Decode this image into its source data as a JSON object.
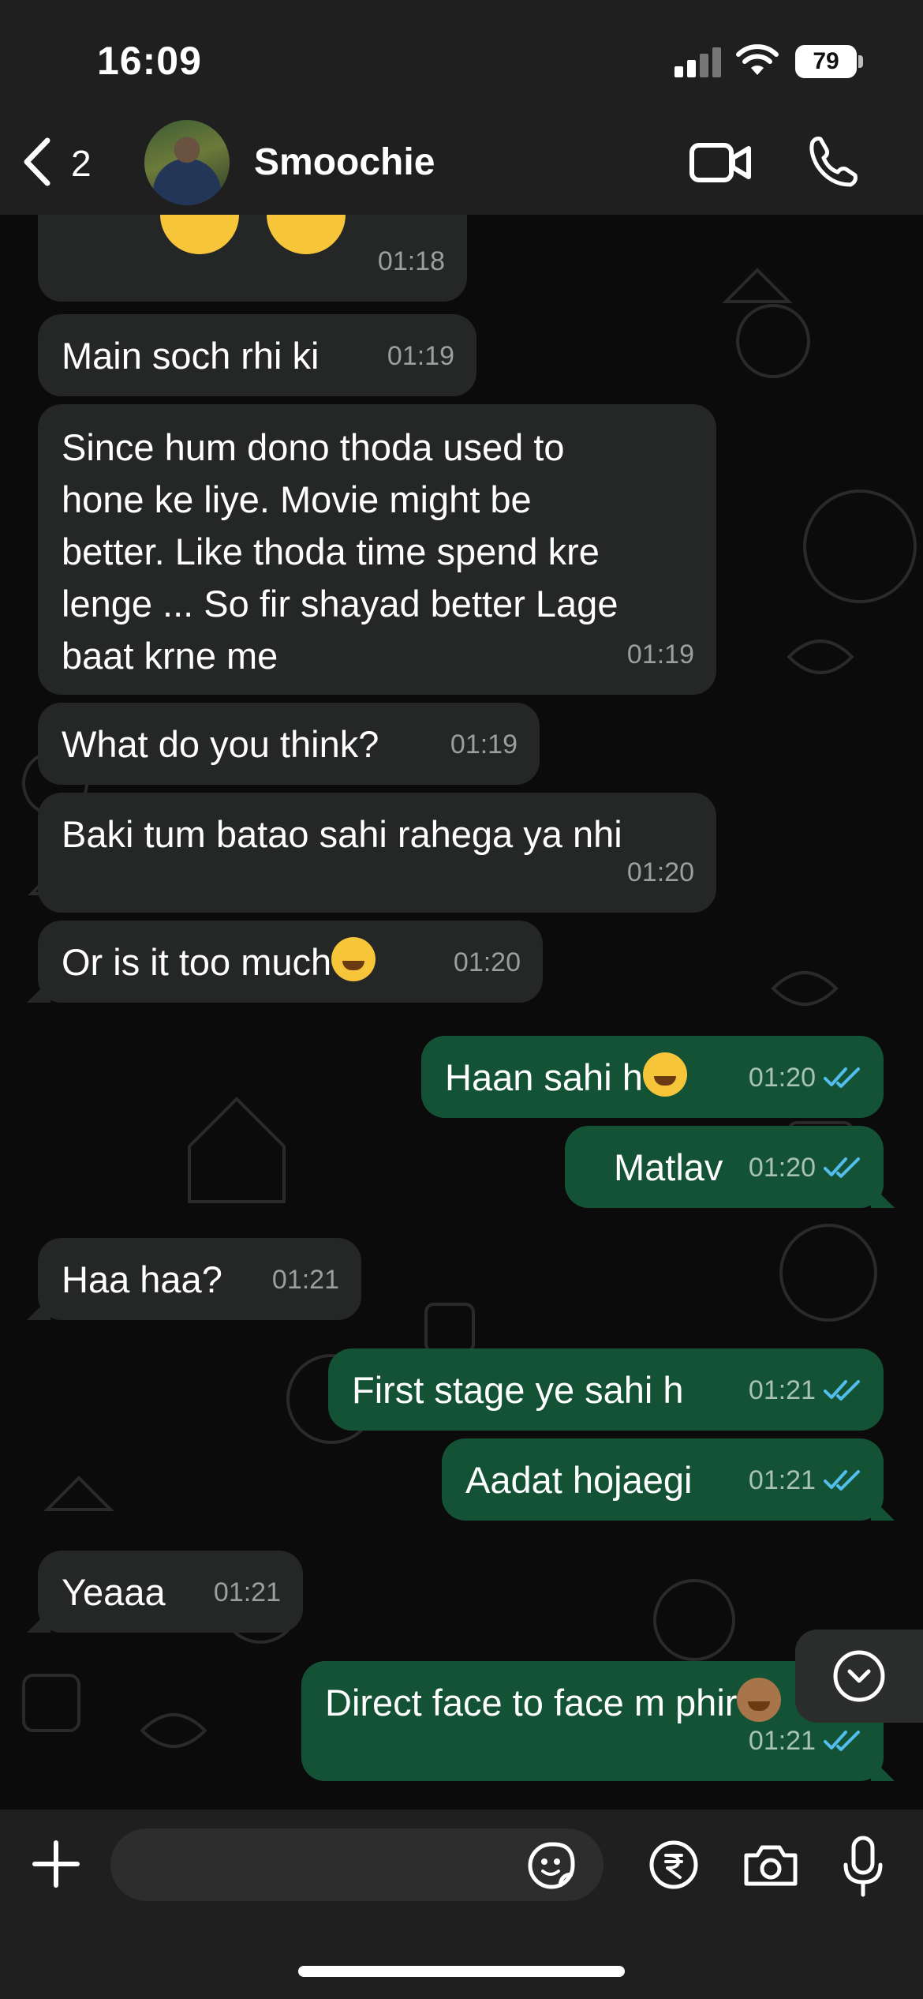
{
  "status_bar": {
    "time": "16:09",
    "battery": "79"
  },
  "header": {
    "back_count": "2",
    "contact_name": "Smoochie"
  },
  "messages": [
    {
      "dir": "in",
      "text": "",
      "time": "01:18"
    },
    {
      "dir": "in",
      "text": "Main soch rhi ki",
      "time": "01:19"
    },
    {
      "dir": "in",
      "text": "Since hum dono thoda used to\nhone ke liye. Movie might be\nbetter. Like thoda time spend kre\nlenge ... So fir shayad better Lage\nbaat krne me",
      "time": "01:19"
    },
    {
      "dir": "in",
      "text": "What do you think?",
      "time": "01:19"
    },
    {
      "dir": "in",
      "text": "Baki tum batao sahi rahega ya nhi",
      "time": "01:20"
    },
    {
      "dir": "in",
      "text": "Or is it too much",
      "time": "01:20",
      "emoji": "rolling-laughing"
    },
    {
      "dir": "out",
      "text": "Haan sahi h",
      "time": "01:20",
      "emoji": "hand-over-mouth",
      "read": true
    },
    {
      "dir": "out",
      "text": "Matlav",
      "time": "01:20",
      "read": true
    },
    {
      "dir": "in",
      "text": "Haa haa?",
      "time": "01:21"
    },
    {
      "dir": "out",
      "text": "First stage ye sahi h",
      "time": "01:21",
      "read": true
    },
    {
      "dir": "out",
      "text": "Aadat hojaegi",
      "time": "01:21",
      "read": true
    },
    {
      "dir": "in",
      "text": "Yeaaa",
      "time": "01:21"
    },
    {
      "dir": "out",
      "text": "Direct face to face m phir",
      "time": "01:21",
      "emoji": "monkey",
      "read": true
    }
  ],
  "input": {
    "placeholder": ""
  },
  "icons": {
    "back": "chevron-left-icon",
    "video": "video-camera-icon",
    "call": "phone-icon",
    "plus": "plus-icon",
    "sticker": "sticker-icon",
    "payment": "rupee-icon",
    "camera": "camera-icon",
    "mic": "microphone-icon",
    "scroll": "chevron-down-icon",
    "read_receipt": "double-check-icon"
  },
  "colors": {
    "incoming_bubble": "#252626",
    "outgoing_bubble": "#145236",
    "read_tick": "#53bdeb",
    "chat_background": "#0b0b0b",
    "bars": "#1f1f1f"
  }
}
